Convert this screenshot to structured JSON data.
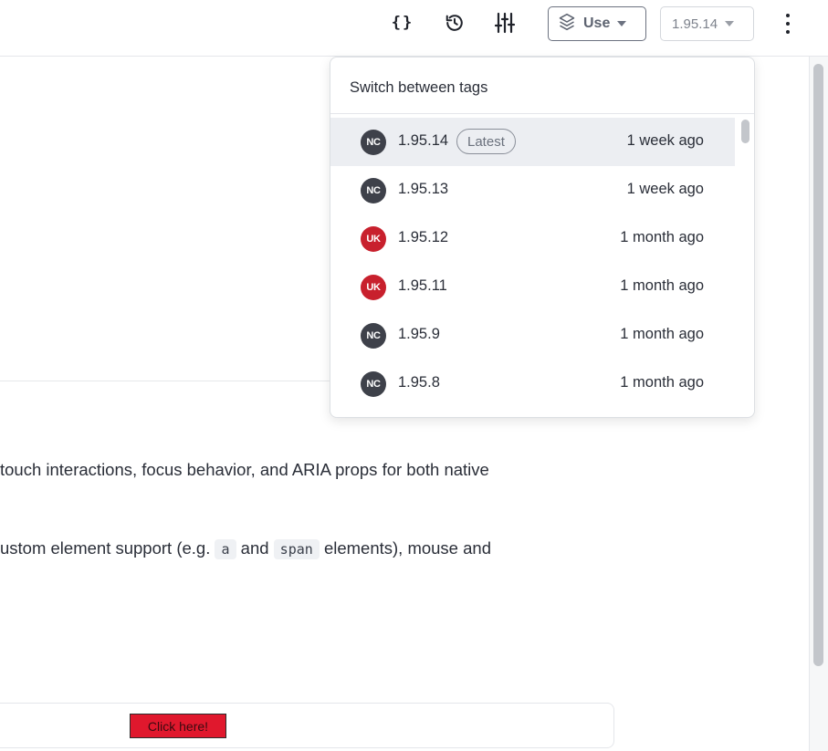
{
  "toolbar": {
    "braces_label": "{}",
    "use_label": "Use",
    "version_label": "1.95.14"
  },
  "content": {
    "para1": "touch interactions, focus behavior, and ARIA props for both native",
    "para2_a": "ustom element support (e.g.",
    "code_a": "a",
    "para2_and": "and",
    "code_span": "span",
    "para2_b": "elements), mouse and",
    "button_label": "Click here!"
  },
  "dropdown": {
    "title": "Switch between tags",
    "latest_badge": "Latest",
    "items": [
      {
        "avatar": "NC",
        "tag": "1.95.14",
        "time": "1 week ago",
        "selected": true
      },
      {
        "avatar": "NC",
        "tag": "1.95.13",
        "time": "1 week ago"
      },
      {
        "avatar": "UK",
        "tag": "1.95.12",
        "time": "1 month ago"
      },
      {
        "avatar": "UK",
        "tag": "1.95.11",
        "time": "1 month ago"
      },
      {
        "avatar": "NC",
        "tag": "1.95.9",
        "time": "1 month ago"
      },
      {
        "avatar": "NC",
        "tag": "1.95.8",
        "time": "1 month ago"
      }
    ]
  },
  "colors": {
    "avatar_nc": "#3e414a",
    "avatar_uk": "#c8202d",
    "button_red": "#e0182d",
    "selected_row": "#eceef2"
  },
  "icons": [
    "braces-icon",
    "history-icon",
    "sliders-icon",
    "package-icon",
    "caret-down-icon",
    "kebab-icon"
  ]
}
